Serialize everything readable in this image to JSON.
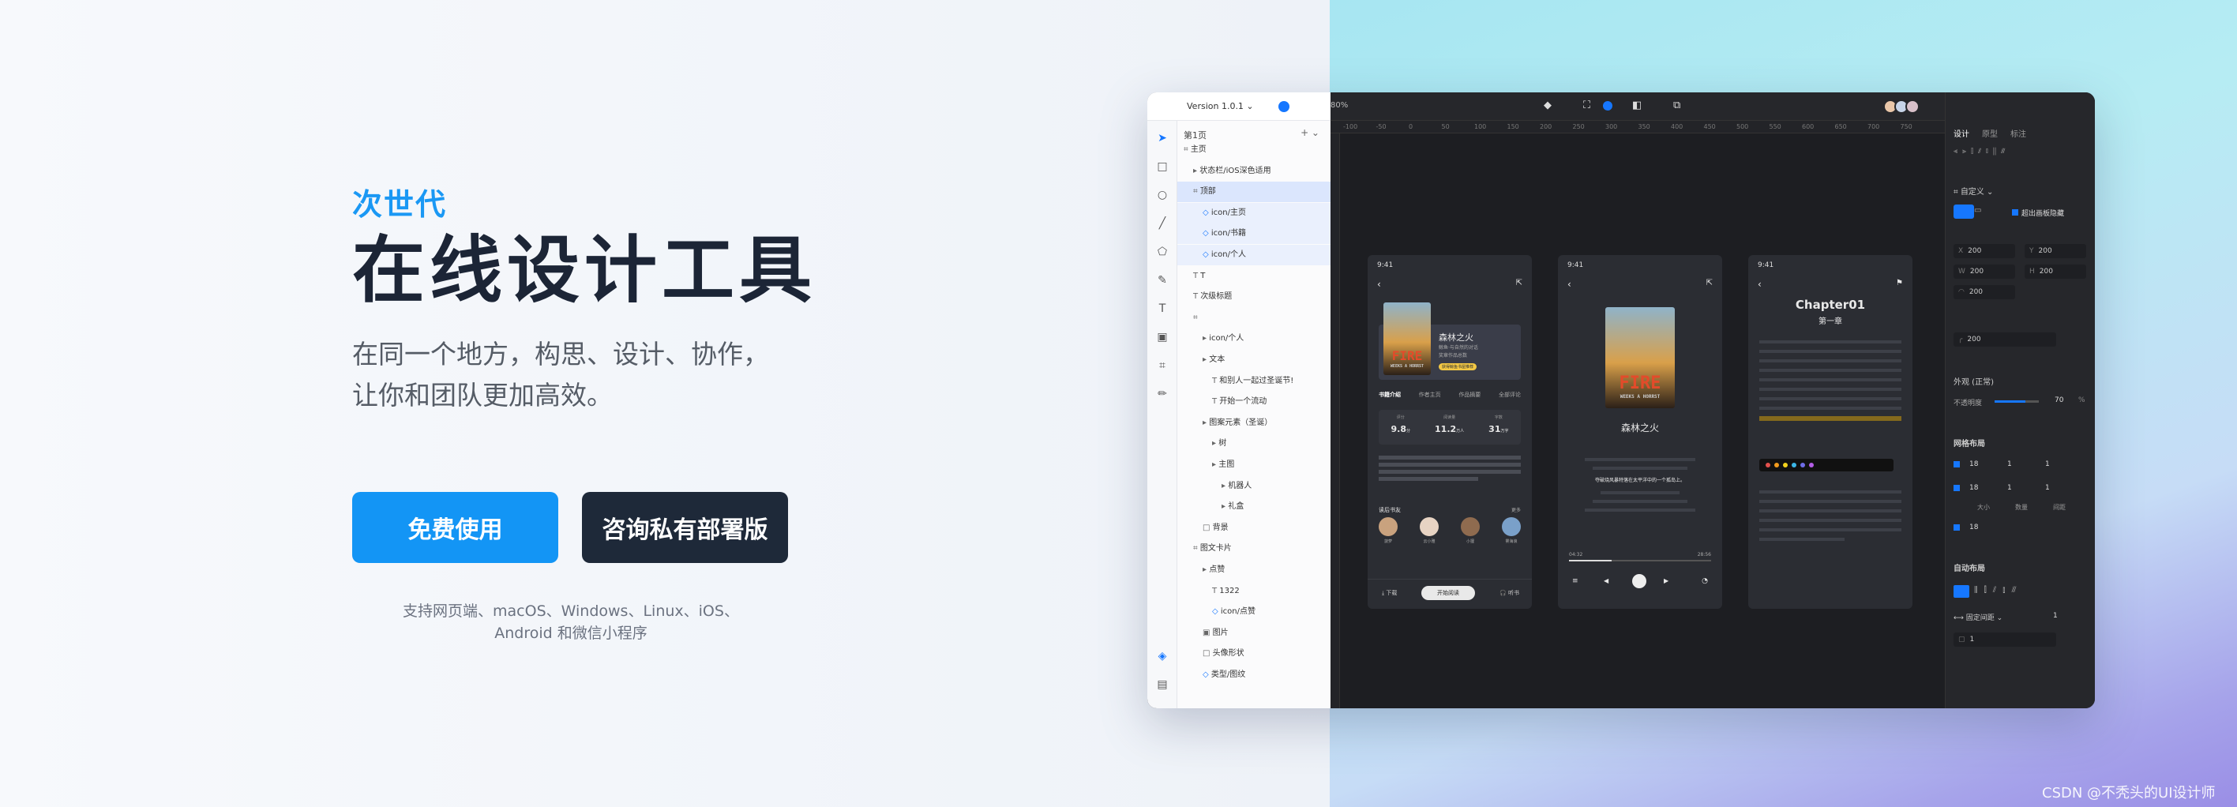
{
  "hero": {
    "eyebrow": "次世代",
    "headline": "在线设计工具",
    "sub_line1": "在同一个地方，构思、设计、协作，",
    "sub_line2": "让你和团队更加高效。",
    "btn_free": "免费使用",
    "btn_private": "咨询私有部署版",
    "platforms_line1": "支持网页端、macOS、Windows、Linux、iOS、",
    "platforms_line2": "Android 和微信小程序"
  },
  "app": {
    "version": "Version 1.0.1",
    "zoom": "80%",
    "page": "第1页",
    "layers": [
      "主页",
      "状态栏/iOS深色适用",
      "顶部",
      "icon/主页",
      "icon/书籍",
      "icon/个人",
      "T",
      "次级标题",
      "",
      "icon/个人",
      "文本",
      "和别人一起过圣诞节!",
      "开始一个流动",
      "图案元素（圣诞）",
      "树",
      "主图",
      "机器人",
      "礼盒",
      "背景",
      "图文卡片",
      "点赞",
      "1322",
      "icon/点赞",
      "图片",
      "头像形状",
      "类型/图纹"
    ],
    "ruler_ticks": [
      "-100",
      "-50",
      "0",
      "50",
      "100",
      "150",
      "200",
      "250",
      "300",
      "350",
      "400",
      "450",
      "500",
      "550",
      "600",
      "650",
      "700",
      "750"
    ],
    "tabs": [
      "设计",
      "原型",
      "标注"
    ],
    "frame_select": "自定义",
    "clip_label": "超出画板隐藏",
    "x_label": "X",
    "x_val": "200",
    "y_label": "Y",
    "y_val": "200",
    "w_label": "W",
    "w_val": "200",
    "h_label": "H",
    "h_val": "200",
    "rot_val": "200",
    "radius_val": "200",
    "appearance": "外观 (正常)",
    "opacity_label": "不透明度",
    "opacity_val": "70",
    "opacity_unit": "%",
    "grid_layout": "网格布局",
    "grid_vals": [
      "18",
      "1",
      "1",
      "18",
      "1",
      "1",
      "18"
    ],
    "grid_labels": [
      "大小",
      "数量",
      "间距"
    ],
    "auto_layout": "自动布局",
    "fixed_spacing": "固定间距",
    "auto_val1": "1",
    "auto_val2": "1"
  },
  "phones": {
    "time": "9:41",
    "p1": {
      "book_title": "森林之火",
      "book_meta1": "鲸鱼·与自然的对话",
      "book_meta2": "奖章作品总数",
      "badge": "获得鲸鱼书屋推荐",
      "tabs": [
        "书籍介绍",
        "作者主页",
        "作品摘要",
        "全部评论"
      ],
      "stats_labels": [
        "评分",
        "阅读量",
        "字数"
      ],
      "stats": [
        "9.8",
        "11.2",
        "31"
      ],
      "stats_units": [
        "分",
        "万人",
        "万字"
      ],
      "readers_label": "读后书友",
      "more": "更多",
      "readers": [
        "菠萝",
        "云小雅",
        "小狸",
        "雾海浪"
      ],
      "bottom": [
        "下载",
        "开始阅读",
        "听书"
      ]
    },
    "p2": {
      "title": "森林之火",
      "time_start": "04:32",
      "time_end": "28:56",
      "highlight": "夺破烧风暴特落在太平洋中的一个孤岛上。"
    },
    "p3": {
      "chapter": "Chapter01",
      "chapter_cn": "第一章"
    },
    "fire_word": "FIRE",
    "fire_sub": "WEEKS A HORRST"
  },
  "watermark": "CSDN @不秃头的UI设计师",
  "colors": {
    "accent": "#1395f5",
    "dark_button": "#1e2939",
    "selection": "#dbe6fd"
  }
}
